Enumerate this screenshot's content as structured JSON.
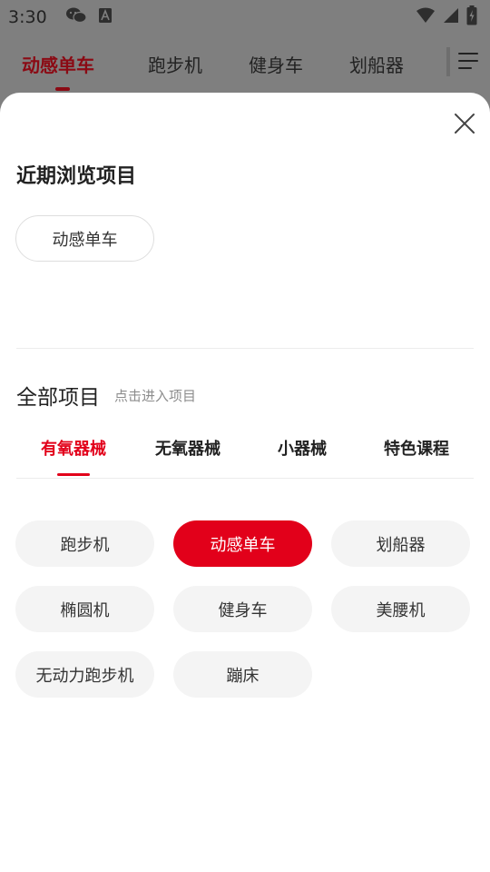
{
  "status_bar": {
    "time": "3:30"
  },
  "top_tabs": [
    {
      "label": "动感单车",
      "active": true
    },
    {
      "label": "跑步机",
      "active": false
    },
    {
      "label": "健身车",
      "active": false
    },
    {
      "label": "划船器",
      "active": false
    }
  ],
  "recent": {
    "title": "近期浏览项目",
    "items": [
      "动感单车"
    ]
  },
  "all": {
    "title": "全部项目",
    "hint": "点击进入项目",
    "tabs": [
      "有氧器械",
      "无氧器械",
      "小器械",
      "特色课程"
    ],
    "active_tab": "有氧器械",
    "items": [
      "跑步机",
      "动感单车",
      "划船器",
      "椭圆机",
      "健身车",
      "美腰机",
      "无动力跑步机",
      "蹦床"
    ],
    "selected_item": "动感单车"
  },
  "colors": {
    "accent": "#e2001a",
    "chip_bg": "#f4f4f4",
    "overlay": "#7f7f7f"
  },
  "icons": [
    "wechat-icon",
    "font-icon",
    "wifi-icon",
    "signal-icon",
    "battery-icon",
    "menu-icon",
    "close-icon"
  ]
}
